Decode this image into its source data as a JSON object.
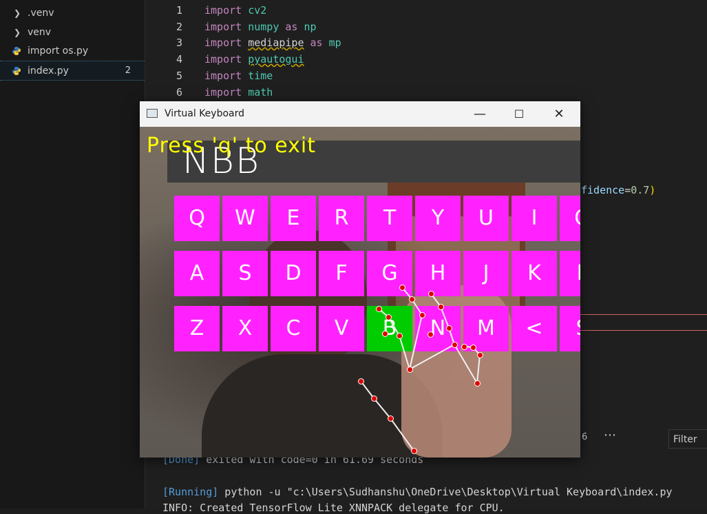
{
  "colors": {
    "key_bg": "#ff22ff",
    "key_active_bg": "#00cc00",
    "hint_text": "#ffff00",
    "landmark": "#e00000"
  },
  "explorer": {
    "items": [
      {
        "label": ".venv",
        "type": "folder",
        "icon": "chevron-right-icon"
      },
      {
        "label": "venv",
        "type": "folder",
        "icon": "chevron-right-icon"
      },
      {
        "label": "import os.py",
        "type": "file",
        "icon": "python-file-icon"
      },
      {
        "label": "index.py",
        "type": "file",
        "icon": "python-file-icon",
        "badge": "2",
        "active": true
      }
    ]
  },
  "editor": {
    "lines": [
      {
        "num": "1",
        "kw": "import",
        "name": "cv2"
      },
      {
        "num": "2",
        "kw": "import",
        "name": "numpy",
        "as": "as",
        "alias": "np"
      },
      {
        "num": "3",
        "kw": "import",
        "name": "mediapipe",
        "as": "as",
        "alias": "mp"
      },
      {
        "num": "4",
        "kw": "import",
        "name": "pyautogui"
      },
      {
        "num": "5",
        "kw": "import",
        "name": "time"
      },
      {
        "num": "6",
        "kw": "import",
        "name": "math"
      }
    ],
    "partial_line": {
      "attr": "fidence",
      "eq": "=",
      "value": "0.7",
      "close": ")"
    }
  },
  "panel": {
    "count": "6",
    "more_icon": "ellipsis-icon",
    "filter_placeholder": "Filter"
  },
  "terminal": {
    "done_tag": "[Done]",
    "done_text": " exited with code=0 in 61.69 seconds",
    "running_tag": "[Running]",
    "running_cmd": " python -u \"c:\\Users\\Sudhanshu\\OneDrive\\Desktop\\Virtual Keyboard\\index.py",
    "info": "INFO: Created TensorFlow Lite XNNPACK delegate for CPU."
  },
  "window": {
    "title": "Virtual Keyboard",
    "app_icon": "window-app-icon",
    "minimize": "—",
    "maximize": "☐",
    "close": "✕"
  },
  "keyboard": {
    "typed_text": "NBB",
    "hint": "Press 'q' to exit",
    "rows": [
      [
        "Q",
        "W",
        "E",
        "R",
        "T",
        "Y",
        "U",
        "I",
        "O"
      ],
      [
        "A",
        "S",
        "D",
        "F",
        "G",
        "H",
        "J",
        "K",
        "L"
      ],
      [
        "Z",
        "X",
        "C",
        "V",
        "B",
        "N",
        "M",
        "<",
        "S"
      ]
    ],
    "active_key": "B"
  }
}
